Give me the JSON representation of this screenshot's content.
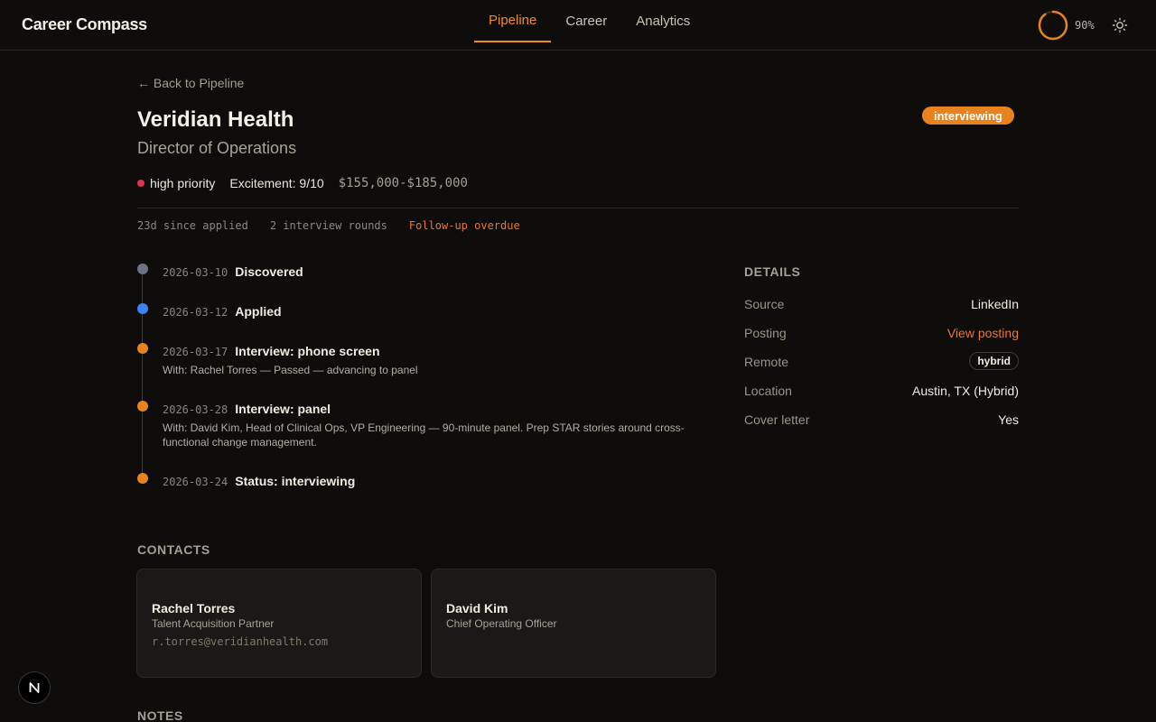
{
  "app": {
    "title": "Career Compass"
  },
  "nav": {
    "tabs": [
      {
        "label": "Pipeline",
        "active": true
      },
      {
        "label": "Career",
        "active": false
      },
      {
        "label": "Analytics",
        "active": false
      }
    ]
  },
  "progress": {
    "value": 0.9,
    "label": "90%"
  },
  "theme_toggle": {
    "icon": "sun-icon"
  },
  "job": {
    "back_label": "← Back to Pipeline",
    "company": "Veridian Health",
    "role": "Director of Operations",
    "status": "interviewing",
    "priority": "high priority",
    "excitement": "Excitement: 9/10",
    "salary": "$155,000-$185,000",
    "days_since": "23d since applied",
    "rounds": "2 interview rounds",
    "followup": "Follow-up overdue"
  },
  "timeline": [
    {
      "date": "2026-03-10",
      "title": "Discovered",
      "note": "",
      "color": "#6b7385"
    },
    {
      "date": "2026-03-12",
      "title": "Applied",
      "note": "",
      "color": "#3b82f6"
    },
    {
      "date": "2026-03-17",
      "title": "Interview: phone screen",
      "note": "With: Rachel Torres — Passed — advancing to panel",
      "color": "#e8821c"
    },
    {
      "date": "2026-03-28",
      "title": "Interview: panel",
      "note": "With: David Kim, Head of Clinical Ops, VP Engineering — 90-minute panel. Prep STAR stories around cross-functional change management.",
      "color": "#e8821c"
    },
    {
      "date": "2026-03-24",
      "title": "Status: interviewing",
      "note": "",
      "color": "#e8821c"
    }
  ],
  "details": {
    "title": "DETAILS",
    "rows": [
      {
        "key": "Source",
        "value": "LinkedIn"
      },
      {
        "key": "Posting",
        "value": "View posting"
      },
      {
        "key": "Remote",
        "value": "hybrid"
      },
      {
        "key": "Location",
        "value": "Austin, TX (Hybrid)"
      },
      {
        "key": "Cover letter",
        "value": "Yes"
      }
    ]
  },
  "contacts": {
    "title": "CONTACTS",
    "items": [
      {
        "name": "Rachel Torres",
        "role": "Talent Acquisition Partner",
        "email": "r.torres@veridianhealth.com"
      },
      {
        "name": "David Kim",
        "role": "Chief Operating Officer",
        "email": ""
      }
    ]
  },
  "notes": {
    "title": "NOTES"
  },
  "dev_badge": {
    "label": "N"
  }
}
